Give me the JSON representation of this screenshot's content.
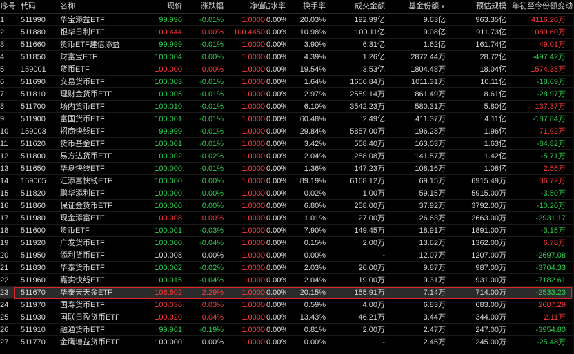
{
  "colors": {
    "up": "#ff3b3b",
    "down": "#2bd14d",
    "highlight_border": "#e02424",
    "background": "#000000"
  },
  "header": {
    "seq": "序号",
    "code": "代码",
    "name": "名称",
    "price": "现价",
    "change": "涨跌幅",
    "nav": "净值",
    "discount": "贴水率",
    "turnover": "换手率",
    "amount": "成交金额",
    "shares": "基金份额",
    "shares_sort_icon": "sort-down-icon",
    "size": "预估规模",
    "delta": "年初至今份额变动"
  },
  "rows": [
    {
      "seq": "1",
      "code": "511990",
      "name": "华宝添益ETF",
      "price": "99.996",
      "change": "-0.01%",
      "nav": "1.0000",
      "discount": "0.00%",
      "turnover": "20.03%",
      "amount": "192.99亿",
      "shares": "9.63亿",
      "size": "963.35亿",
      "delta": "4116.26万",
      "price_dir": "down",
      "change_dir": "down",
      "delta_dir": "up"
    },
    {
      "seq": "2",
      "code": "511880",
      "name": "银华日利ETF",
      "price": "100.444",
      "change": "0.00%",
      "nav": "100.4450",
      "discount": "0.00%",
      "turnover": "10.98%",
      "amount": "100.11亿",
      "shares": "9.08亿",
      "size": "911.73亿",
      "delta": "1089.60万",
      "price_dir": "up",
      "change_dir": "up",
      "nav_dir": "up",
      "delta_dir": "up"
    },
    {
      "seq": "3",
      "code": "511660",
      "name": "货币ETF建信添益",
      "price": "99.999",
      "change": "-0.01%",
      "nav": "1.0000",
      "discount": "0.00%",
      "turnover": "3.90%",
      "amount": "6.31亿",
      "shares": "1.62亿",
      "size": "161.74亿",
      "delta": "49.01万",
      "price_dir": "down",
      "change_dir": "down",
      "delta_dir": "up"
    },
    {
      "seq": "4",
      "code": "511850",
      "name": "财富宝ETF",
      "price": "100.004",
      "change": "0.00%",
      "nav": "1.0000",
      "discount": "0.00%",
      "turnover": "4.39%",
      "amount": "1.26亿",
      "shares": "2872.44万",
      "size": "28.72亿",
      "delta": "-497.42万",
      "price_dir": "down",
      "change_dir": "down",
      "delta_dir": "down"
    },
    {
      "seq": "5",
      "code": "159001",
      "name": "货币ETF",
      "price": "100.000",
      "change": "0.00%",
      "nav": "1.0000",
      "discount": "0.00%",
      "turnover": "19.54%",
      "amount": "3.53亿",
      "shares": "1804.48万",
      "size": "18.04亿",
      "delta": "1574.38万",
      "price_dir": "up",
      "change_dir": "up",
      "delta_dir": "up"
    },
    {
      "seq": "6",
      "code": "511690",
      "name": "交易货币ETF",
      "price": "100.003",
      "change": "-0.01%",
      "nav": "1.0000",
      "discount": "0.00%",
      "turnover": "1.64%",
      "amount": "1656.84万",
      "shares": "1011.31万",
      "size": "10.11亿",
      "delta": "-18.69万",
      "price_dir": "down",
      "change_dir": "down",
      "delta_dir": "down"
    },
    {
      "seq": "7",
      "code": "511810",
      "name": "理财金货币ETF",
      "price": "100.005",
      "change": "-0.01%",
      "nav": "1.0000",
      "discount": "0.00%",
      "turnover": "2.97%",
      "amount": "2559.14万",
      "shares": "861.49万",
      "size": "8.61亿",
      "delta": "-28.97万",
      "price_dir": "down",
      "change_dir": "down",
      "delta_dir": "down"
    },
    {
      "seq": "8",
      "code": "511700",
      "name": "场内货币ETF",
      "price": "100.010",
      "change": "-0.01%",
      "nav": "1.0000",
      "discount": "0.00%",
      "turnover": "6.10%",
      "amount": "3542.23万",
      "shares": "580.31万",
      "size": "5.80亿",
      "delta": "137.37万",
      "price_dir": "down",
      "change_dir": "down",
      "delta_dir": "up"
    },
    {
      "seq": "9",
      "code": "511900",
      "name": "富国货币ETF",
      "price": "100.001",
      "change": "-0.01%",
      "nav": "1.0000",
      "discount": "0.00%",
      "turnover": "60.48%",
      "amount": "2.49亿",
      "shares": "411.37万",
      "size": "4.11亿",
      "delta": "-187.84万",
      "price_dir": "down",
      "change_dir": "down",
      "delta_dir": "down"
    },
    {
      "seq": "10",
      "code": "159003",
      "name": "招商快线ETF",
      "price": "99.999",
      "change": "-0.01%",
      "nav": "1.0000",
      "discount": "0.00%",
      "turnover": "29.84%",
      "amount": "5857.00万",
      "shares": "196.28万",
      "size": "1.96亿",
      "delta": "71.92万",
      "price_dir": "down",
      "change_dir": "down",
      "delta_dir": "up"
    },
    {
      "seq": "11",
      "code": "511620",
      "name": "货币基金ETF",
      "price": "100.001",
      "change": "-0.01%",
      "nav": "1.0000",
      "discount": "0.00%",
      "turnover": "3.42%",
      "amount": "558.40万",
      "shares": "163.03万",
      "size": "1.63亿",
      "delta": "-84.82万",
      "price_dir": "down",
      "change_dir": "down",
      "delta_dir": "down"
    },
    {
      "seq": "12",
      "code": "511800",
      "name": "易方达货币ETF",
      "price": "100.002",
      "change": "-0.02%",
      "nav": "1.0000",
      "discount": "0.00%",
      "turnover": "2.04%",
      "amount": "288.08万",
      "shares": "141.57万",
      "size": "1.42亿",
      "delta": "-5.71万",
      "price_dir": "down",
      "change_dir": "down",
      "delta_dir": "down"
    },
    {
      "seq": "13",
      "code": "511650",
      "name": "华夏快线ETF",
      "price": "100.000",
      "change": "-0.01%",
      "nav": "1.0000",
      "discount": "0.00%",
      "turnover": "1.36%",
      "amount": "147.23万",
      "shares": "108.16万",
      "size": "1.08亿",
      "delta": "2.56万",
      "price_dir": "down",
      "change_dir": "down",
      "delta_dir": "up"
    },
    {
      "seq": "14",
      "code": "159005",
      "name": "汇添富快钱ETF",
      "price": "100.000",
      "change": "0.00%",
      "nav": "1.0000",
      "discount": "0.00%",
      "turnover": "89.19%",
      "amount": "6168.12万",
      "shares": "69.15万",
      "size": "6915.49万",
      "delta": "36.72万",
      "price_dir": "down",
      "change_dir": "down",
      "delta_dir": "up"
    },
    {
      "seq": "15",
      "code": "511820",
      "name": "鹏华添利ETF",
      "price": "100.000",
      "change": "0.00%",
      "nav": "1.0000",
      "discount": "0.00%",
      "turnover": "0.02%",
      "amount": "1.00万",
      "shares": "59.15万",
      "size": "5915.00万",
      "delta": "-3.50万",
      "price_dir": "down",
      "change_dir": "down",
      "delta_dir": "down"
    },
    {
      "seq": "16",
      "code": "511860",
      "name": "保证金货币ETF",
      "price": "100.000",
      "change": "0.00%",
      "nav": "1.0000",
      "discount": "0.00%",
      "turnover": "6.80%",
      "amount": "258.00万",
      "shares": "37.92万",
      "size": "3792.00万",
      "delta": "-10.20万",
      "price_dir": "down",
      "change_dir": "down",
      "delta_dir": "down"
    },
    {
      "seq": "17",
      "code": "511980",
      "name": "现金添富ETF",
      "price": "100.008",
      "change": "0.00%",
      "nav": "1.0000",
      "discount": "0.00%",
      "turnover": "1.01%",
      "amount": "27.00万",
      "shares": "26.63万",
      "size": "2663.00万",
      "delta": "-2931.17",
      "price_dir": "up",
      "change_dir": "up",
      "delta_dir": "down"
    },
    {
      "seq": "18",
      "code": "511600",
      "name": "货币ETF",
      "price": "100.001",
      "change": "-0.03%",
      "nav": "1.0000",
      "discount": "0.00%",
      "turnover": "7.90%",
      "amount": "149.45万",
      "shares": "18.91万",
      "size": "1891.00万",
      "delta": "-3.15万",
      "price_dir": "down",
      "change_dir": "down",
      "delta_dir": "down"
    },
    {
      "seq": "19",
      "code": "511920",
      "name": "广发货币ETF",
      "price": "100.000",
      "change": "-0.04%",
      "nav": "1.0000",
      "discount": "0.00%",
      "turnover": "0.15%",
      "amount": "2.00万",
      "shares": "13.62万",
      "size": "1362.00万",
      "delta": "6.78万",
      "price_dir": "down",
      "change_dir": "down",
      "delta_dir": "up"
    },
    {
      "seq": "20",
      "code": "511950",
      "name": "添利货币ETF",
      "price": "100.008",
      "change": "0.00%",
      "nav": "1.0000",
      "discount": "0.00%",
      "turnover": "0.00%",
      "amount": "-",
      "shares": "12.07万",
      "size": "1207.00万",
      "delta": "-2697.08",
      "price_dir": "flat",
      "change_dir": "flat",
      "delta_dir": "down"
    },
    {
      "seq": "21",
      "code": "511830",
      "name": "华泰货币ETF",
      "price": "100.002",
      "change": "-0.02%",
      "nav": "1.0000",
      "discount": "0.00%",
      "turnover": "2.03%",
      "amount": "20.00万",
      "shares": "9.87万",
      "size": "987.00万",
      "delta": "-3704.33",
      "price_dir": "down",
      "change_dir": "down",
      "delta_dir": "down"
    },
    {
      "seq": "22",
      "code": "511960",
      "name": "嘉实快线ETF",
      "price": "100.015",
      "change": "-0.04%",
      "nav": "1.0000",
      "discount": "0.00%",
      "turnover": "2.04%",
      "amount": "19.00万",
      "shares": "9.31万",
      "size": "931.00万",
      "delta": "-7182.61",
      "price_dir": "down",
      "change_dir": "down",
      "delta_dir": "down"
    },
    {
      "seq": "23",
      "code": "511670",
      "name": "华泰天天金ETF",
      "price": "108.602",
      "change": "2.29%",
      "nav": "1.0000",
      "discount": "0.00%",
      "turnover": "20.15%",
      "amount": "155.91万",
      "shares": "7.14万",
      "size": "714.00万",
      "delta": "-2533.23",
      "price_dir": "up",
      "change_dir": "up",
      "delta_dir": "down",
      "highlight": true
    },
    {
      "seq": "24",
      "code": "511970",
      "name": "国寿货币ETF",
      "price": "100.036",
      "change": "0.03%",
      "nav": "1.0000",
      "discount": "0.00%",
      "turnover": "0.59%",
      "amount": "4.00万",
      "shares": "6.83万",
      "size": "683.00万",
      "delta": "2607.29",
      "price_dir": "up",
      "change_dir": "up",
      "delta_dir": "up"
    },
    {
      "seq": "25",
      "code": "511930",
      "name": "国联日盈货币ETF",
      "price": "100.020",
      "change": "0.04%",
      "nav": "1.0000",
      "discount": "0.00%",
      "turnover": "13.43%",
      "amount": "46.21万",
      "shares": "3.44万",
      "size": "344.00万",
      "delta": "2.11万",
      "price_dir": "up",
      "change_dir": "up",
      "delta_dir": "up"
    },
    {
      "seq": "26",
      "code": "511910",
      "name": "融通货币ETF",
      "price": "99.961",
      "change": "-0.19%",
      "nav": "1.0000",
      "discount": "0.00%",
      "turnover": "0.81%",
      "amount": "2.00万",
      "shares": "2.47万",
      "size": "247.00万",
      "delta": "-3954.80",
      "price_dir": "down",
      "change_dir": "down",
      "delta_dir": "down"
    },
    {
      "seq": "27",
      "code": "511770",
      "name": "金鹰增益货币ETF",
      "price": "100.000",
      "change": "0.00%",
      "nav": "1.0000",
      "discount": "0.00%",
      "turnover": "0.00%",
      "amount": "-",
      "shares": "2.45万",
      "size": "245.00万",
      "delta": "-25.48万",
      "price_dir": "flat",
      "change_dir": "flat",
      "delta_dir": "down"
    }
  ]
}
